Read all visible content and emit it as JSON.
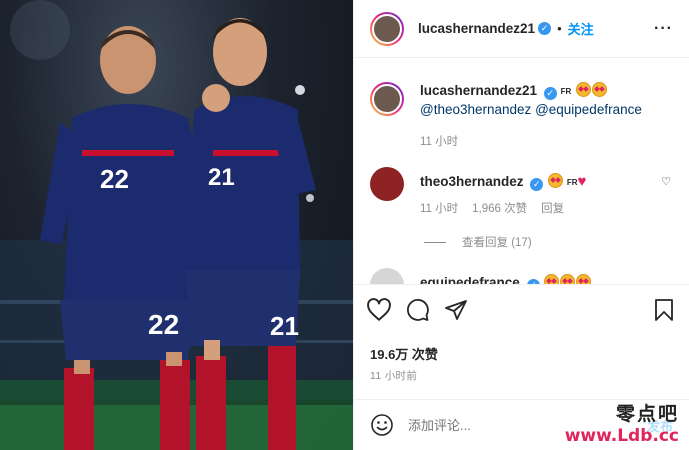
{
  "post": {
    "author": "lucashernandez21",
    "follow_label": "关注",
    "caption": {
      "username": "lucashernandez21",
      "flag": "FR",
      "mentions": [
        "@theo3hernandez",
        "@equipedefrance"
      ],
      "time": "11 小时"
    },
    "comments": [
      {
        "username": "theo3hernandez",
        "flag": "FR",
        "time": "11 小时",
        "likes": "1,966 次赞",
        "reply_label": "回复",
        "view_replies": "查看回复 (17)"
      },
      {
        "username": "equipedefrance"
      }
    ],
    "likes": "19.6万 次赞",
    "time_ago": "11 小时前",
    "add_comment_placeholder": "添加评论...",
    "post_button": "发布",
    "photo": {
      "jersey_left": "22",
      "jersey_right": "21"
    }
  },
  "watermark": {
    "line1": "零点吧",
    "line2": "www.Ldb.cc"
  },
  "colors": {
    "accent": "#0095f6",
    "verified": "#3897f0",
    "jersey_blue": "#1c2a6e",
    "jersey_red": "#c8102e",
    "heart": "#e0245e"
  },
  "icons": [
    "more-icon",
    "heart-icon",
    "comment-icon",
    "share-icon",
    "save-icon",
    "emoji-icon",
    "verified-icon"
  ]
}
